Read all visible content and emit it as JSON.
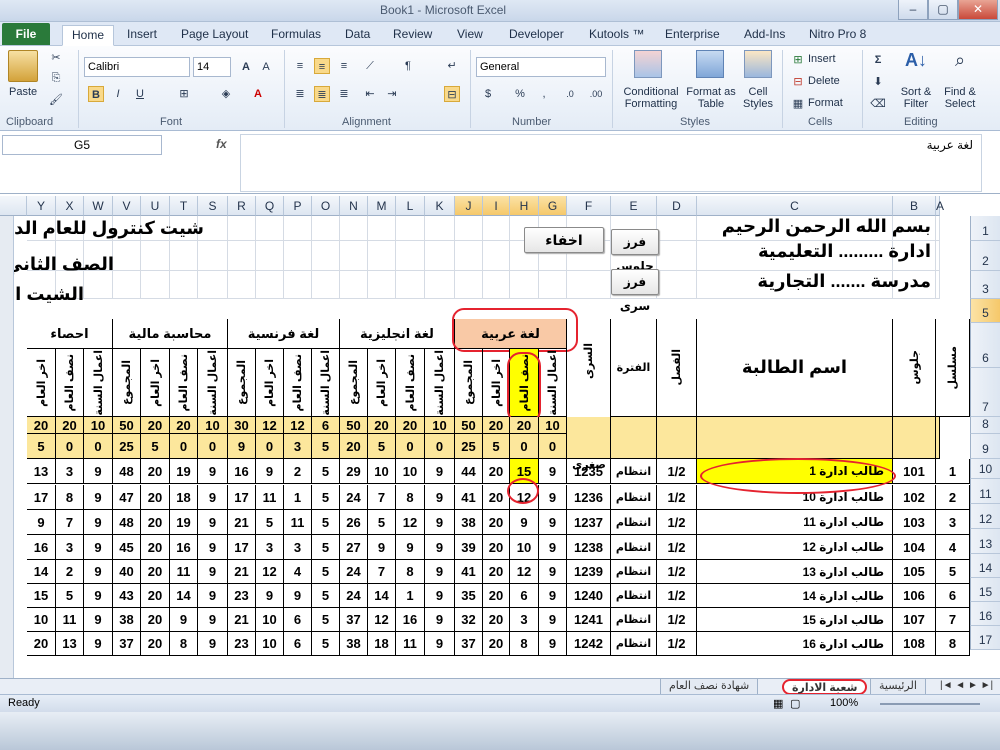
{
  "window": {
    "title": "Book1 - Microsoft Excel",
    "min": "–",
    "max": "▢",
    "close": "✕"
  },
  "tabs": {
    "file": "File",
    "items": [
      "Home",
      "Insert",
      "Page Layout",
      "Formulas",
      "Data",
      "Review",
      "View",
      "Developer",
      "Kutools ™",
      "Enterprise",
      "Add-Ins",
      "Nitro Pro 8"
    ]
  },
  "ribbon": {
    "paste": "Paste",
    "clipboard": "Clipboard",
    "font_name": "Calibri",
    "font_size": "14",
    "font": "Font",
    "alignment": "Alignment",
    "number_format": "General",
    "number": "Number",
    "conditional": "Conditional Formatting",
    "format_table": "Format as Table",
    "cell_styles": "Cell Styles",
    "styles": "Styles",
    "insert": "Insert",
    "delete": "Delete",
    "format": "Format",
    "cells": "Cells",
    "sort": "Sort & Filter",
    "find": "Find & Select",
    "editing": "Editing"
  },
  "formula_bar": {
    "name_box": "G5",
    "fx": "fx",
    "content": "لغة عربية"
  },
  "columns": [
    "A",
    "B",
    "C",
    "D",
    "E",
    "F",
    "G",
    "H",
    "I",
    "J",
    "K",
    "L",
    "M",
    "N",
    "O",
    "P",
    "Q",
    "R",
    "S",
    "T",
    "U",
    "V",
    "W",
    "X",
    "Y"
  ],
  "rows": [
    "1",
    "2",
    "3",
    "5",
    "6",
    "7",
    "8",
    "9",
    "10",
    "11",
    "12",
    "13",
    "14",
    "15",
    "16",
    "17"
  ],
  "sheet": {
    "header1": "بسم الله الرحمن الرحيم",
    "header2": "ادارة ......... التعليمية",
    "header3": "مدرسة ....... التجارية",
    "title1": "شيت كنترول للعام الد",
    "title2": "الصف الثاني",
    "title3": "الشيت ال",
    "btn_hide": "اخفاء",
    "btn_sort_seat": "فرز جلوس",
    "btn_sort_secret": "فرز سرى",
    "col_serial": "مسلسل",
    "col_seat": "جلوس",
    "col_name": "اسم الطالبة",
    "col_class": "الفصل",
    "col_period": "الفترة",
    "col_secret": "السرى",
    "max_label": "عظمى",
    "min_label": "صغرى",
    "subjects": [
      "لغة عربية",
      "لغة انجليزية",
      "لغة فرنسية",
      "محاسبة مالية",
      "احصاء"
    ],
    "sub_headers": [
      "اعمال السنة",
      "نصف العام",
      "اخر العام",
      "المجموع"
    ],
    "max_values": [
      "10",
      "20",
      "20",
      "50",
      "10",
      "20",
      "20",
      "50",
      "6",
      "12",
      "12",
      "30",
      "10",
      "20",
      "20",
      "50",
      "10",
      "20",
      "20"
    ],
    "min_values": [
      "0",
      "0",
      "5",
      "25",
      "0",
      "0",
      "5",
      "20",
      "5",
      "3",
      "0",
      "9",
      "0",
      "0",
      "5",
      "25",
      "0",
      "0",
      "5"
    ],
    "students": [
      {
        "serial": "1",
        "seat": "101",
        "name": "طالب ادارة 1",
        "class": "1/2",
        "period": "انتظام",
        "secret": "1235",
        "marks": [
          "9",
          "15",
          "20",
          "44",
          "9",
          "10",
          "10",
          "29",
          "5",
          "2",
          "9",
          "16",
          "9",
          "19",
          "20",
          "48",
          "9",
          "3",
          "13"
        ]
      },
      {
        "serial": "2",
        "seat": "102",
        "name": "طالب ادارة 10",
        "class": "1/2",
        "period": "انتظام",
        "secret": "1236",
        "marks": [
          "9",
          "12",
          "20",
          "41",
          "9",
          "8",
          "7",
          "24",
          "5",
          "1",
          "11",
          "17",
          "9",
          "18",
          "20",
          "47",
          "9",
          "8",
          "17"
        ]
      },
      {
        "serial": "3",
        "seat": "103",
        "name": "طالب ادارة 11",
        "class": "1/2",
        "period": "انتظام",
        "secret": "1237",
        "marks": [
          "9",
          "9",
          "20",
          "38",
          "9",
          "12",
          "5",
          "26",
          "5",
          "11",
          "5",
          "21",
          "9",
          "19",
          "20",
          "48",
          "9",
          "7",
          "9"
        ]
      },
      {
        "serial": "4",
        "seat": "104",
        "name": "طالب ادارة 12",
        "class": "1/2",
        "period": "انتظام",
        "secret": "1238",
        "marks": [
          "9",
          "10",
          "20",
          "39",
          "9",
          "9",
          "9",
          "27",
          "5",
          "3",
          "3",
          "17",
          "9",
          "16",
          "20",
          "45",
          "9",
          "3",
          "16"
        ]
      },
      {
        "serial": "5",
        "seat": "105",
        "name": "طالب ادارة 13",
        "class": "1/2",
        "period": "انتظام",
        "secret": "1239",
        "marks": [
          "9",
          "12",
          "20",
          "41",
          "9",
          "8",
          "7",
          "24",
          "5",
          "4",
          "12",
          "21",
          "9",
          "11",
          "20",
          "40",
          "9",
          "2",
          "14"
        ]
      },
      {
        "serial": "6",
        "seat": "106",
        "name": "طالب ادارة 14",
        "class": "1/2",
        "period": "انتظام",
        "secret": "1240",
        "marks": [
          "9",
          "6",
          "20",
          "35",
          "9",
          "1",
          "14",
          "24",
          "5",
          "9",
          "9",
          "23",
          "9",
          "14",
          "20",
          "43",
          "9",
          "5",
          "15"
        ]
      },
      {
        "serial": "7",
        "seat": "107",
        "name": "طالب ادارة 15",
        "class": "1/2",
        "period": "انتظام",
        "secret": "1241",
        "marks": [
          "9",
          "3",
          "20",
          "32",
          "9",
          "16",
          "12",
          "37",
          "5",
          "6",
          "10",
          "21",
          "9",
          "9",
          "20",
          "38",
          "9",
          "11",
          "10"
        ]
      },
      {
        "serial": "8",
        "seat": "108",
        "name": "طالب ادارة 16",
        "class": "1/2",
        "period": "انتظام",
        "secret": "1242",
        "marks": [
          "9",
          "8",
          "20",
          "37",
          "9",
          "11",
          "18",
          "38",
          "5",
          "6",
          "10",
          "23",
          "9",
          "8",
          "20",
          "37",
          "9",
          "13",
          "20"
        ]
      }
    ]
  },
  "sheet_tabs": [
    "الرئيسية",
    "شعبة الادارة",
    "شهادة نصف العام"
  ],
  "status": {
    "ready": "Ready",
    "zoom": "100%"
  },
  "colors": {
    "highlight": "#ffff00",
    "header_fill": "#fce79c",
    "selected_subject": "#f9c9a6",
    "annotation": "#e5232f"
  }
}
